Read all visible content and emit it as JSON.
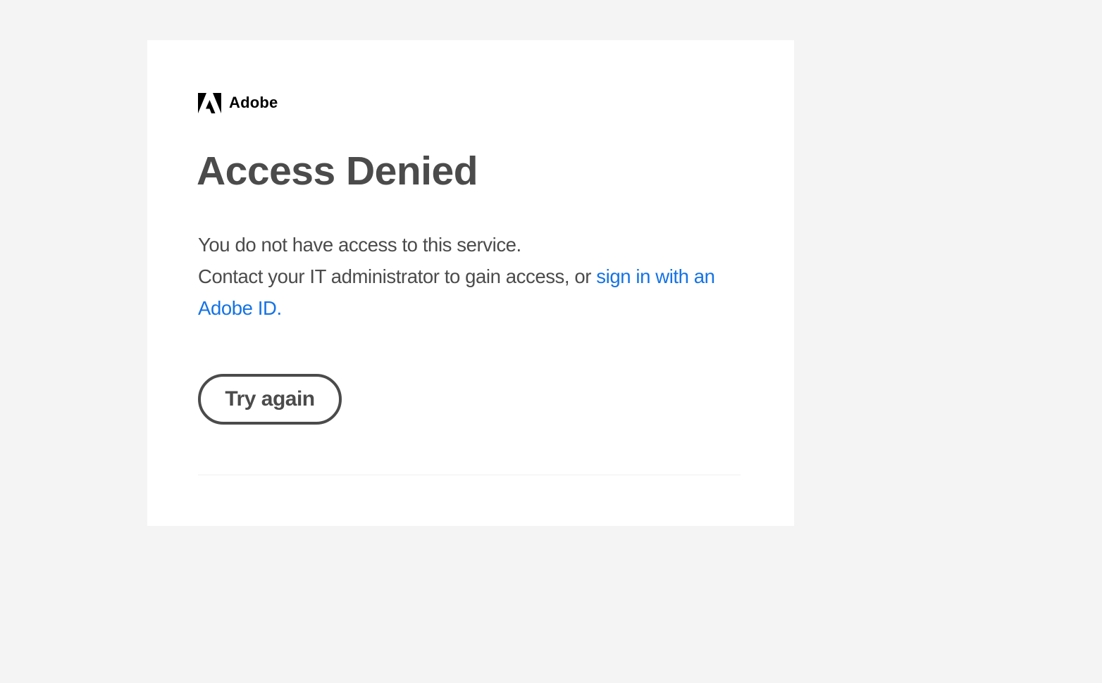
{
  "brand": {
    "logo_icon": "adobe-logo-icon",
    "name": "Adobe",
    "logo_color": "#000000"
  },
  "page": {
    "title": "Access Denied",
    "message_line1": "You do not have access to this service.",
    "message_line2_prefix": "Contact your IT administrator to gain access, or ",
    "sign_in_link": "sign in with an Adobe ID.",
    "try_again_label": "Try again"
  },
  "colors": {
    "page_background": "#f4f4f4",
    "card_background": "#ffffff",
    "text": "#4b4b4b",
    "link": "#1473e6"
  }
}
